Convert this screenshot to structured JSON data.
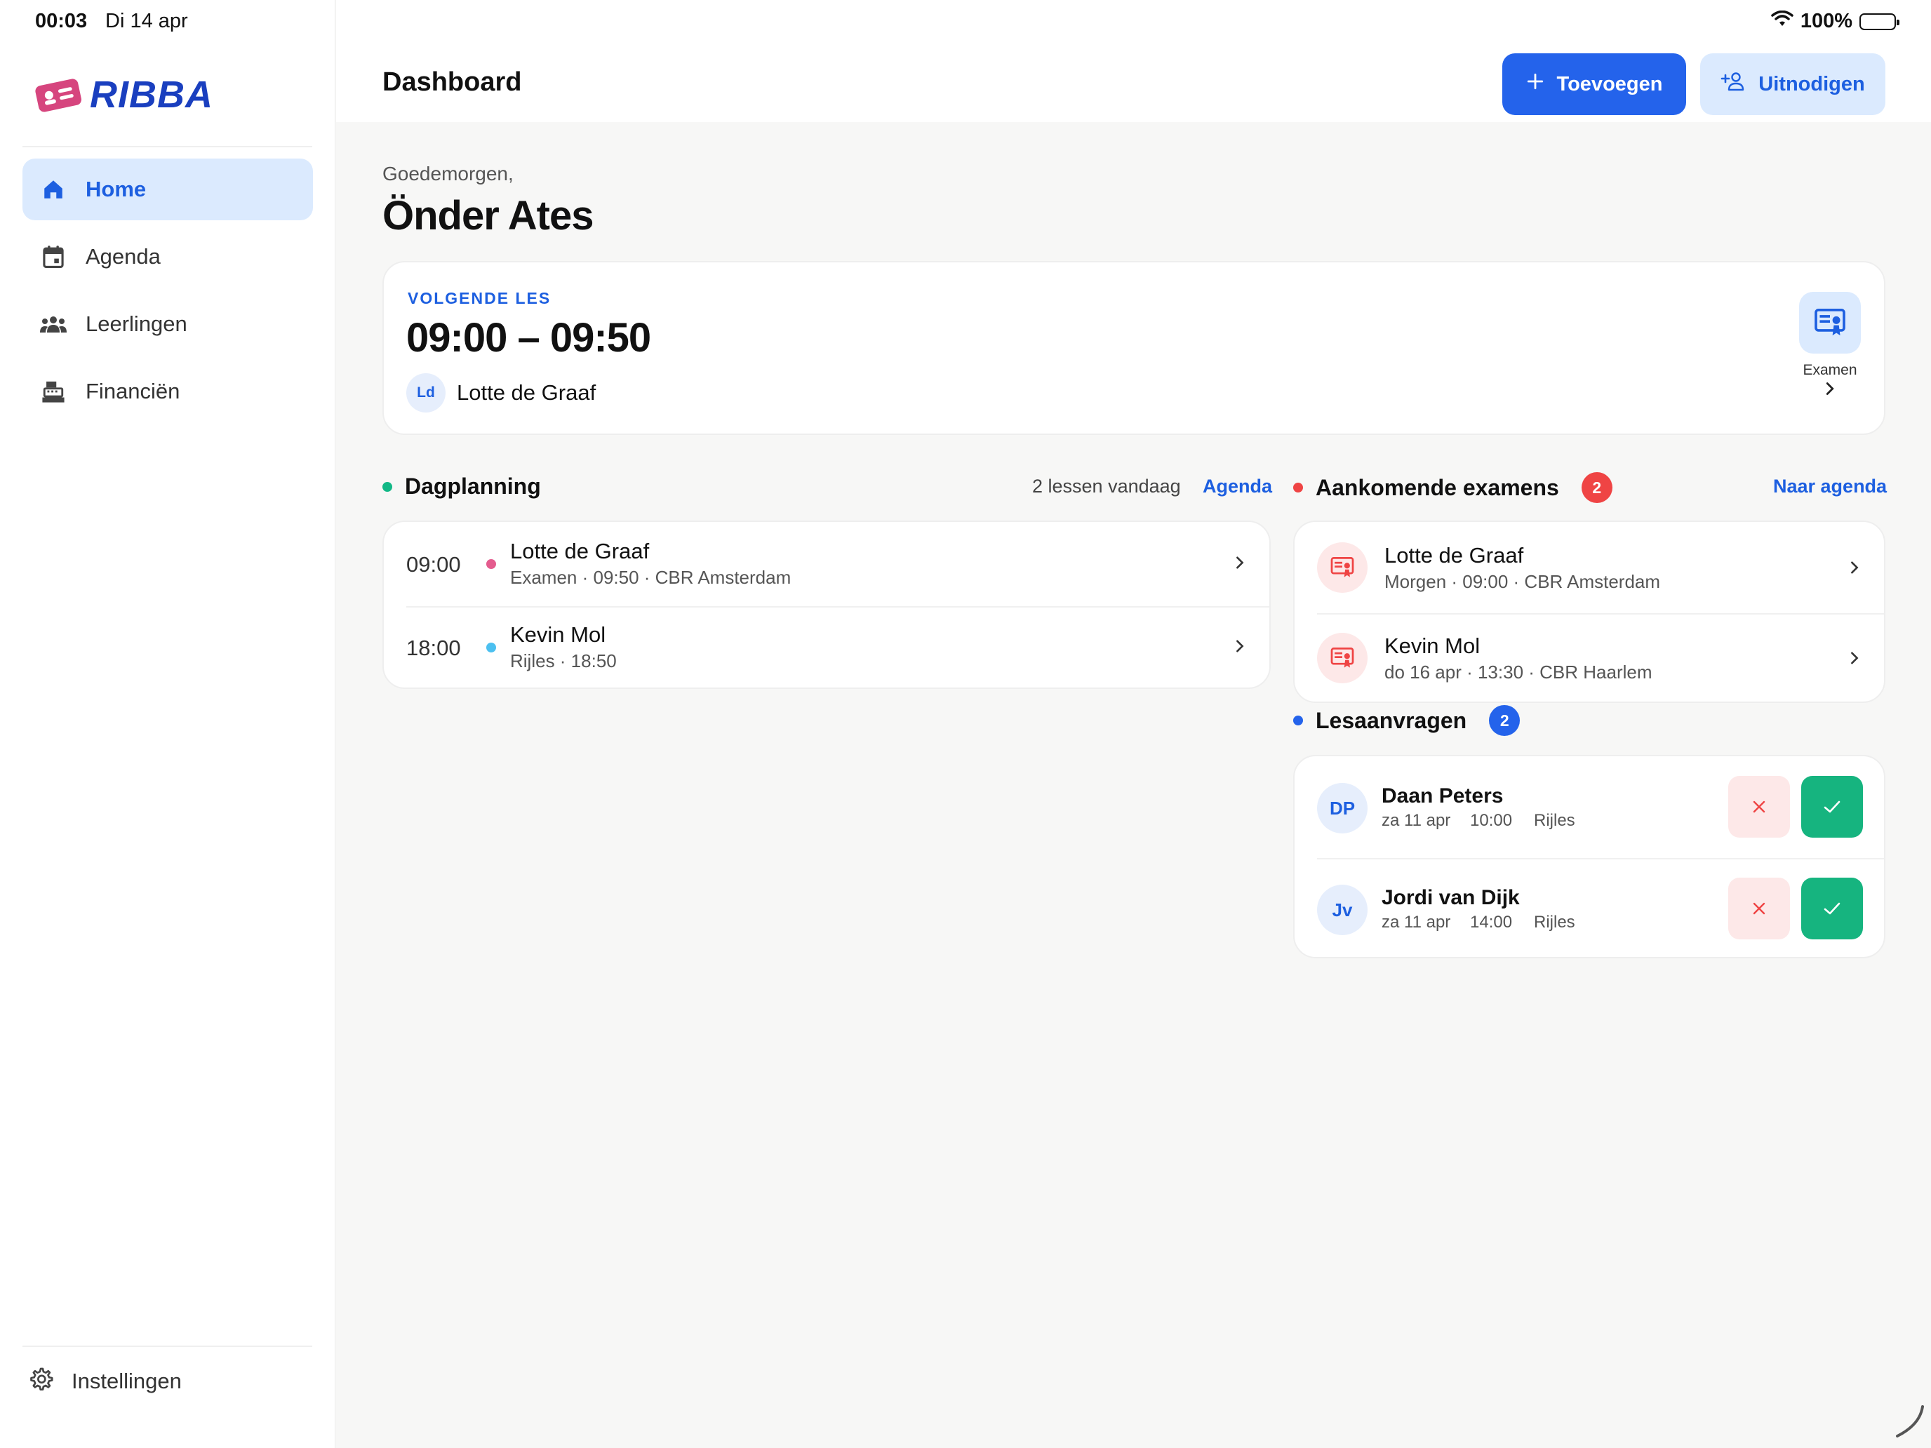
{
  "status": {
    "time": "00:03",
    "date": "Di 14 apr",
    "battery": "100%"
  },
  "brand": {
    "name": "RIBBA"
  },
  "sidebar": {
    "items": [
      {
        "label": "Home",
        "icon": "home-icon",
        "active": true
      },
      {
        "label": "Agenda",
        "icon": "calendar-icon",
        "active": false
      },
      {
        "label": "Leerlingen",
        "icon": "people-icon",
        "active": false
      },
      {
        "label": "Financiën",
        "icon": "cash-register-icon",
        "active": false
      }
    ],
    "settings_label": "Instellingen"
  },
  "header": {
    "title": "Dashboard",
    "add_label": "Toevoegen",
    "invite_label": "Uitnodigen"
  },
  "greeting": {
    "text": "Goedemorgen,",
    "name": "Önder Ates"
  },
  "next_lesson": {
    "label": "VOLGENDE LES",
    "time": "09:00 – 09:50",
    "initials": "Ld",
    "student": "Lotte de Graaf",
    "exam_label": "Examen"
  },
  "day_planning": {
    "title": "Dagplanning",
    "count_text": "2 lessen vandaag",
    "link": "Agenda",
    "rows": [
      {
        "time": "09:00",
        "name": "Lotte de Graaf",
        "detail": "Examen · 09:50 · CBR Amsterdam",
        "dot_color": "#e45c8e"
      },
      {
        "time": "18:00",
        "name": "Kevin Mol",
        "detail": "Rijles · 18:50",
        "dot_color": "#4cc0f0"
      }
    ]
  },
  "upcoming_exams": {
    "title": "Aankomende examens",
    "badge": "2",
    "link": "Naar agenda",
    "rows": [
      {
        "name": "Lotte de Graaf",
        "detail": "Morgen · 09:00 · CBR Amsterdam"
      },
      {
        "name": "Kevin Mol",
        "detail": "do 16 apr · 13:30 · CBR Haarlem"
      }
    ]
  },
  "lesson_requests": {
    "title": "Lesaanvragen",
    "badge": "2",
    "rows": [
      {
        "initials": "DP",
        "name": "Daan Peters",
        "date": "za 11 apr",
        "time": "10:00",
        "type": "Rijles"
      },
      {
        "initials": "Jv",
        "name": "Jordi van Dijk",
        "date": "za 11 apr",
        "time": "14:00",
        "type": "Rijles"
      }
    ]
  },
  "colors": {
    "accent": "#2463eb",
    "accent_light": "#dbeafe",
    "danger": "#ef4444",
    "success": "#16b47f",
    "green_dot": "#12b886"
  }
}
